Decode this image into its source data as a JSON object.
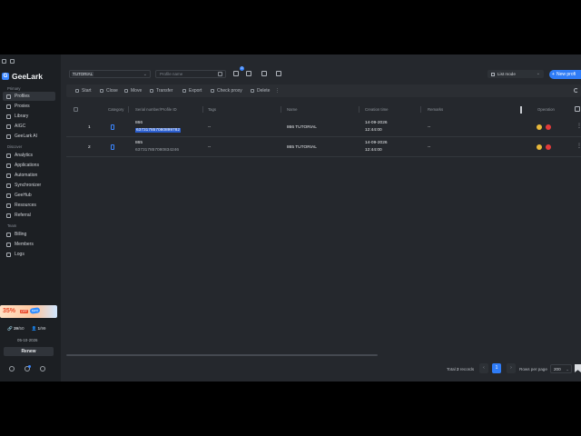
{
  "app": {
    "name": "GeeLark"
  },
  "sidebar": {
    "primary_title": "Primary",
    "primary_items": [
      {
        "label": "Profiles",
        "icon": "profiles-icon",
        "active": true
      },
      {
        "label": "Proxies",
        "icon": "proxies-icon"
      },
      {
        "label": "Library",
        "icon": "library-icon"
      },
      {
        "label": "AIGC",
        "icon": "aigc-icon"
      },
      {
        "label": "GeeLark AI",
        "icon": "ai-icon"
      }
    ],
    "discover_title": "Discover",
    "discover_items": [
      {
        "label": "Analytics",
        "icon": "analytics-icon"
      },
      {
        "label": "Applications",
        "icon": "applications-icon"
      },
      {
        "label": "Automation",
        "icon": "automation-icon"
      },
      {
        "label": "Synchronizer",
        "icon": "synchronizer-icon"
      },
      {
        "label": "GeeHub",
        "icon": "geehub-icon"
      },
      {
        "label": "Resources",
        "icon": "resources-icon"
      },
      {
        "label": "Referral",
        "icon": "referral-icon"
      }
    ],
    "team_title": "Team",
    "team_items": [
      {
        "label": "Billing",
        "icon": "billing-icon"
      },
      {
        "label": "Members",
        "icon": "members-icon"
      },
      {
        "label": "Logs",
        "icon": "logs-icon"
      }
    ],
    "promo": {
      "discount": "35%",
      "off": "OFF",
      "tag": "New"
    },
    "quota": {
      "profiles": "39",
      "profiles_total": "/50",
      "members": "1",
      "members_total": "/99"
    },
    "expire_date": "05-10-2026",
    "renew_label": "Renew"
  },
  "toolbar": {
    "group_tag": "TUTORIAL",
    "search_placeholder": "Profile name",
    "badge_count": "0",
    "view_mode": "List mode",
    "new_profile_label": "New profi"
  },
  "actions": [
    {
      "label": "Start",
      "icon": "play-icon"
    },
    {
      "label": "Close",
      "icon": "close-icon"
    },
    {
      "label": "Move",
      "icon": "move-icon"
    },
    {
      "label": "Transfer",
      "icon": "transfer-icon"
    },
    {
      "label": "Export",
      "icon": "export-icon"
    },
    {
      "label": "Check proxy",
      "icon": "check-proxy-icon"
    },
    {
      "label": "Delete",
      "icon": "delete-icon"
    }
  ],
  "table": {
    "headers": {
      "category": "Category",
      "serial": "Serial number/Profile ID",
      "tags": "Tags",
      "name": "Name",
      "created": "Creation time",
      "remarks": "Remarks",
      "operation": "Operation"
    },
    "rows": [
      {
        "index": "1",
        "serial": "866",
        "profile_id": "637317857080899782",
        "tags": "--",
        "name": "866 TUTORIAL",
        "date": "14-09-2026",
        "time": "12:44:00",
        "remarks": "--"
      },
      {
        "index": "2",
        "serial": "865",
        "profile_id": "637317857080834246",
        "tags": "--",
        "name": "865 TUTORIAL",
        "date": "14-09-2026",
        "time": "12:44:00",
        "remarks": "--"
      }
    ]
  },
  "pagination": {
    "total_prefix": "Total",
    "total_count": "2",
    "total_suffix": "records",
    "current_page": "1",
    "rows_label": "Rows per page",
    "rows_value": "200"
  },
  "colors": {
    "accent": "#2f7cf6",
    "sidebar_bg": "#1c1f23",
    "main_bg": "#25282d"
  }
}
